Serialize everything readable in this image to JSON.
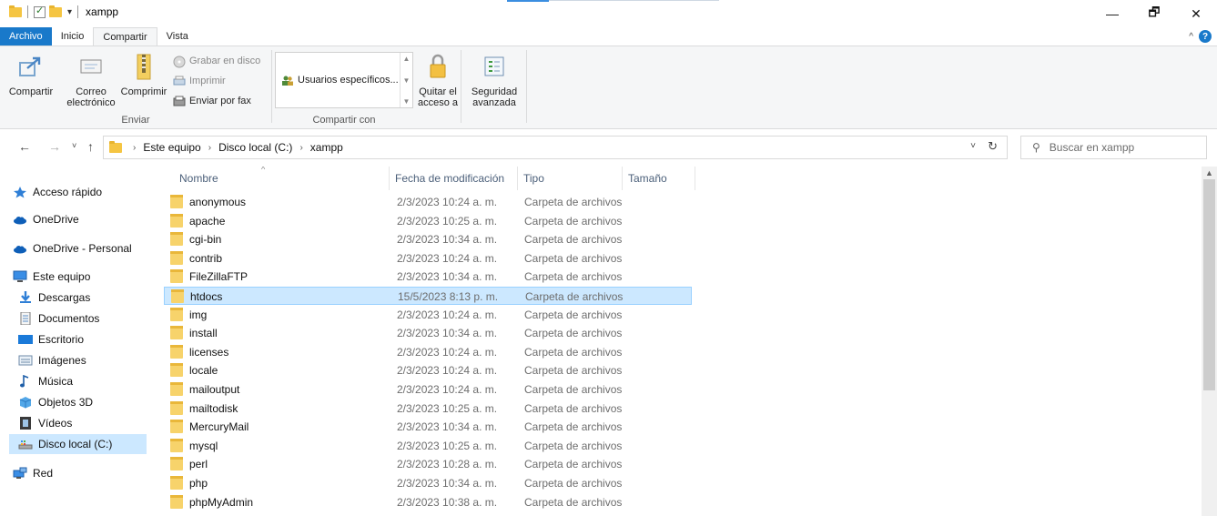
{
  "window": {
    "title": "xampp",
    "minimize": "—",
    "maximize": "🗗",
    "close": "✕"
  },
  "ribbon_tabs": [
    "Archivo",
    "Inicio",
    "Compartir",
    "Vista"
  ],
  "ribbon": {
    "share_label": "Compartir",
    "email_label_1": "Correo",
    "email_label_2": "electrónico",
    "zip_label": "Comprimir",
    "burn_label": "Grabar en disco",
    "print_label": "Imprimir",
    "fax_label": "Enviar por fax",
    "group_send": "Enviar",
    "share_with_item": "Usuarios específicos...",
    "remove_access_1": "Quitar el",
    "remove_access_2": "acceso a",
    "advanced_security_1": "Seguridad",
    "advanced_security_2": "avanzada",
    "group_share_with": "Compartir con"
  },
  "address": {
    "crumbs": [
      "Este equipo",
      "Disco local (C:)",
      "xampp"
    ],
    "search_placeholder": "Buscar en xampp"
  },
  "nav_pane": {
    "quick_access": "Acceso rápido",
    "onedrive": "OneDrive",
    "onedrive_personal": "OneDrive - Personal",
    "this_pc": "Este equipo",
    "downloads": "Descargas",
    "documents": "Documentos",
    "desktop": "Escritorio",
    "pictures": "Imágenes",
    "music": "Música",
    "objects3d": "Objetos 3D",
    "videos": "Vídeos",
    "local_disk": "Disco local (C:)",
    "network": "Red"
  },
  "columns": {
    "name": "Nombre",
    "date": "Fecha de modificación",
    "type": "Tipo",
    "size": "Tamaño"
  },
  "files": [
    {
      "name": "anonymous",
      "date": "2/3/2023 10:24 a. m.",
      "type": "Carpeta de archivos"
    },
    {
      "name": "apache",
      "date": "2/3/2023 10:25 a. m.",
      "type": "Carpeta de archivos"
    },
    {
      "name": "cgi-bin",
      "date": "2/3/2023 10:34 a. m.",
      "type": "Carpeta de archivos"
    },
    {
      "name": "contrib",
      "date": "2/3/2023 10:24 a. m.",
      "type": "Carpeta de archivos"
    },
    {
      "name": "FileZillaFTP",
      "date": "2/3/2023 10:34 a. m.",
      "type": "Carpeta de archivos"
    },
    {
      "name": "htdocs",
      "date": "15/5/2023 8:13 p. m.",
      "type": "Carpeta de archivos"
    },
    {
      "name": "img",
      "date": "2/3/2023 10:24 a. m.",
      "type": "Carpeta de archivos"
    },
    {
      "name": "install",
      "date": "2/3/2023 10:34 a. m.",
      "type": "Carpeta de archivos"
    },
    {
      "name": "licenses",
      "date": "2/3/2023 10:24 a. m.",
      "type": "Carpeta de archivos"
    },
    {
      "name": "locale",
      "date": "2/3/2023 10:24 a. m.",
      "type": "Carpeta de archivos"
    },
    {
      "name": "mailoutput",
      "date": "2/3/2023 10:24 a. m.",
      "type": "Carpeta de archivos"
    },
    {
      "name": "mailtodisk",
      "date": "2/3/2023 10:25 a. m.",
      "type": "Carpeta de archivos"
    },
    {
      "name": "MercuryMail",
      "date": "2/3/2023 10:34 a. m.",
      "type": "Carpeta de archivos"
    },
    {
      "name": "mysql",
      "date": "2/3/2023 10:25 a. m.",
      "type": "Carpeta de archivos"
    },
    {
      "name": "perl",
      "date": "2/3/2023 10:28 a. m.",
      "type": "Carpeta de archivos"
    },
    {
      "name": "php",
      "date": "2/3/2023 10:34 a. m.",
      "type": "Carpeta de archivos"
    },
    {
      "name": "phpMyAdmin",
      "date": "2/3/2023 10:38 a. m.",
      "type": "Carpeta de archivos"
    }
  ],
  "selected_file": "htdocs"
}
